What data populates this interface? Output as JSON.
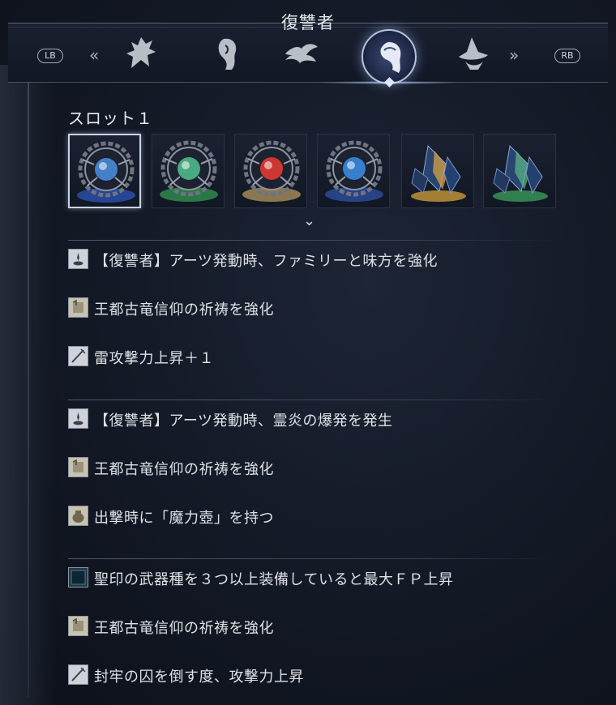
{
  "header": {
    "selected_class": "復讐者",
    "left_shoulder": "LB",
    "right_shoulder": "RB",
    "prev_glyph": "«",
    "next_glyph": "»",
    "classes": [
      {
        "icon": "hooded-figure-icon"
      },
      {
        "icon": "hair-profile-icon"
      },
      {
        "icon": "bird-crest-icon"
      },
      {
        "icon": "revenant-icon",
        "selected": true
      },
      {
        "icon": "witch-hat-icon"
      }
    ]
  },
  "slot": {
    "title": "スロット１",
    "relics": [
      {
        "icon": "relic-orb-blue-icon",
        "glow": "#4a8ad8",
        "base": "#2a4ea8",
        "selected": true
      },
      {
        "icon": "relic-orb-green-icon",
        "glow": "#4fb88a",
        "base": "#2f8a4e"
      },
      {
        "icon": "relic-orb-red-icon",
        "glow": "#e03a30",
        "base": "#a08858"
      },
      {
        "icon": "relic-orb-blue-icon",
        "glow": "#3a8ae0",
        "base": "#2c4a98"
      },
      {
        "icon": "relic-crystal-gold-icon",
        "glow": "#d8a240",
        "base": "#c89a3a"
      },
      {
        "icon": "relic-crystal-green-icon",
        "glow": "#5ab084",
        "base": "#3a9a5a"
      }
    ],
    "expand_glyph": "⌄"
  },
  "effects": [
    [
      {
        "icon": "arts-icon",
        "text": "【復讐者】アーツ発動時、ファミリーと味方を強化"
      },
      {
        "icon": "scroll-icon",
        "text": "王都古竜信仰の祈祷を強化"
      },
      {
        "icon": "weapon-icon",
        "text": "雷攻撃力上昇＋１"
      }
    ],
    [
      {
        "icon": "arts-icon",
        "text": "【復讐者】アーツ発動時、霊炎の爆発を発生"
      },
      {
        "icon": "scroll-icon",
        "text": "王都古竜信仰の祈祷を強化"
      },
      {
        "icon": "pot-icon",
        "text": "出撃時に「魔力壺」を持つ"
      }
    ],
    [
      {
        "icon": "seal-icon",
        "text": "聖印の武器種を３つ以上装備していると最大ＦＰ上昇"
      },
      {
        "icon": "scroll-icon",
        "text": "王都古竜信仰の祈祷を強化"
      },
      {
        "icon": "weapon-icon",
        "text": "封牢の囚を倒す度、攻撃力上昇"
      }
    ]
  ]
}
